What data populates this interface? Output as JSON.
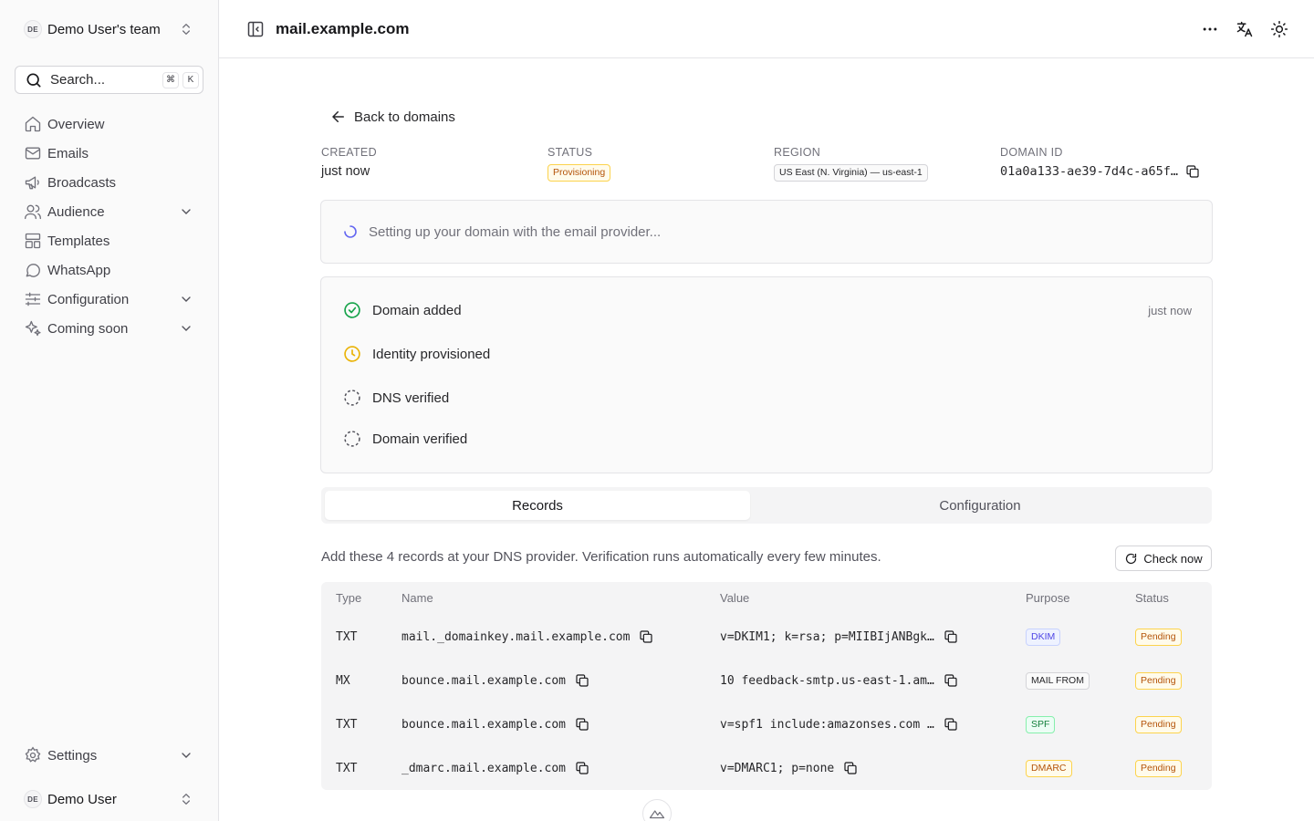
{
  "sidebar": {
    "team": {
      "initials": "DE",
      "name": "Demo User's team"
    },
    "search": {
      "label": "Search...",
      "kbd_mod": "⌘",
      "kbd_key": "K"
    },
    "items": [
      {
        "label": "Overview",
        "icon": "home-icon"
      },
      {
        "label": "Emails",
        "icon": "mail-icon"
      },
      {
        "label": "Broadcasts",
        "icon": "megaphone-icon"
      },
      {
        "label": "Audience",
        "icon": "users-icon"
      },
      {
        "label": "Templates",
        "icon": "layout-icon"
      },
      {
        "label": "WhatsApp",
        "icon": "message-circle-icon"
      },
      {
        "label": "Configuration",
        "icon": "sliders-icon"
      },
      {
        "label": "Coming soon",
        "icon": "sparkles-icon"
      }
    ],
    "settings_label": "Settings",
    "user": {
      "initials": "DE",
      "name": "Demo User"
    }
  },
  "header": {
    "title": "mail.example.com"
  },
  "back_label": "Back to domains",
  "meta": {
    "created": {
      "label": "CREATED",
      "value": "just now"
    },
    "status": {
      "label": "STATUS",
      "value": "Provisioning"
    },
    "region": {
      "label": "REGION",
      "value": "US East (N. Virginia) — us-east-1"
    },
    "domain_id": {
      "label": "DOMAIN ID",
      "value": "01a0a133-ae39-7d4c-a65f…"
    }
  },
  "progress_text": "Setting up your domain with the email provider...",
  "steps": [
    {
      "label": "Domain added",
      "time": "just now",
      "state": "done"
    },
    {
      "label": "Identity provisioned",
      "time": "",
      "state": "pending"
    },
    {
      "label": "DNS verified",
      "time": "",
      "state": "todo"
    },
    {
      "label": "Domain verified",
      "time": "",
      "state": "todo"
    }
  ],
  "tabs": {
    "records": "Records",
    "configuration": "Configuration"
  },
  "instructions": "Add these 4 records at your DNS provider. Verification runs automatically every few minutes.",
  "check_now": "Check now",
  "table": {
    "headers": {
      "type": "Type",
      "name": "Name",
      "value": "Value",
      "purpose": "Purpose",
      "status": "Status"
    },
    "rows": [
      {
        "type": "TXT",
        "name": "mail._domainkey.mail.example.com",
        "value": "v=DKIM1; k=rsa; p=MIIBIjANBgk…",
        "purpose": "DKIM",
        "status": "Pending"
      },
      {
        "type": "MX",
        "name": "bounce.mail.example.com",
        "value": "10 feedback-smtp.us-east-1.am…",
        "purpose": "MAIL FROM",
        "status": "Pending"
      },
      {
        "type": "TXT",
        "name": "bounce.mail.example.com",
        "value": "v=spf1 include:amazonses.com …",
        "purpose": "SPF",
        "status": "Pending"
      },
      {
        "type": "TXT",
        "name": "_dmarc.mail.example.com",
        "value": "v=DMARC1; p=none",
        "purpose": "DMARC",
        "status": "Pending"
      }
    ]
  },
  "colors": {
    "done": "#16a34a",
    "pending": "#eab308",
    "spinner": "#6366f1",
    "border": "#e4e4e7"
  }
}
